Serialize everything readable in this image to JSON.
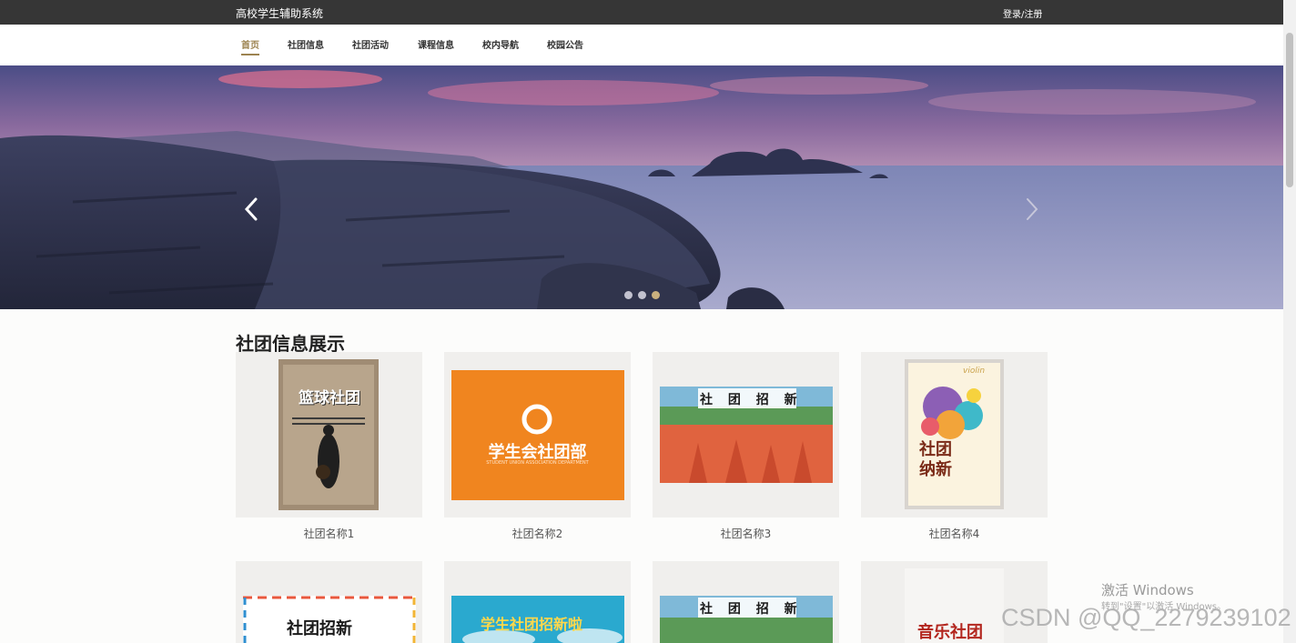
{
  "header": {
    "title": "高校学生辅助系统",
    "login_label": "登录/注册"
  },
  "nav": {
    "items": [
      {
        "label": "首页",
        "active": true
      },
      {
        "label": "社团信息"
      },
      {
        "label": "社团活动"
      },
      {
        "label": "课程信息"
      },
      {
        "label": "校内导航"
      },
      {
        "label": "校园公告"
      }
    ]
  },
  "carousel": {
    "slide_count": 3,
    "active_slide": 3,
    "prev_icon": "chevron-left-icon",
    "next_icon": "chevron-right-icon",
    "image": "seascape-rocks-sunset"
  },
  "clubs": {
    "section_title": "社团信息展示",
    "cards": [
      {
        "name": "社团名称1",
        "poster_text": "篮球社团"
      },
      {
        "name": "社团名称2",
        "poster_text": "学生会社团部",
        "poster_subtext": "STUDENT UNION ASSOCIATION DEPARTMENT"
      },
      {
        "name": "社团名称3",
        "poster_text": "社 团 招 新"
      },
      {
        "name": "社团名称4",
        "poster_text": "社团纳新",
        "poster_subtext": "violin"
      },
      {
        "name": "",
        "poster_text": "社团招新"
      },
      {
        "name": "",
        "poster_text": "学生社团招新啦"
      },
      {
        "name": "",
        "poster_text": "社 团 招 新"
      },
      {
        "name": "",
        "poster_text": "音乐社团"
      }
    ]
  },
  "watermarks": {
    "activate_line1": "激活 Windows",
    "activate_line2": "转到\"设置\"以激活 Windows。",
    "csdn": "CSDN @QQ_2279239102"
  },
  "colors": {
    "topbar": "#363636",
    "accent": "#9c8350",
    "card_bg": "#f0efed",
    "poster_orange": "#f0851f"
  }
}
